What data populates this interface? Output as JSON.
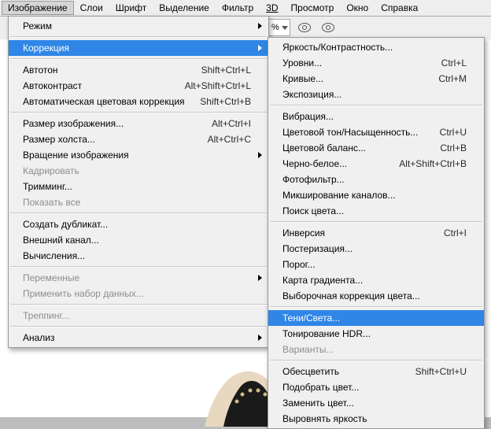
{
  "menubar": {
    "items": [
      {
        "label": "Изображение",
        "active": true
      },
      {
        "label": "Слои"
      },
      {
        "label": "Шрифт"
      },
      {
        "label": "Выделение"
      },
      {
        "label": "Фильтр"
      },
      {
        "label": "3D"
      },
      {
        "label": "Просмотр"
      },
      {
        "label": "Окно"
      },
      {
        "label": "Справка"
      }
    ]
  },
  "toolbar": {
    "percent_suffix": "%"
  },
  "menu1": {
    "mode": "Режим",
    "correction": "Коррекция",
    "autotone": "Автотон",
    "autotone_sc": "Shift+Ctrl+L",
    "autocontrast": "Автоконтраст",
    "autocontrast_sc": "Alt+Shift+Ctrl+L",
    "autocolor": "Автоматическая цветовая коррекция",
    "autocolor_sc": "Shift+Ctrl+B",
    "imagesize": "Размер изображения...",
    "imagesize_sc": "Alt+Ctrl+I",
    "canvassize": "Размер холста...",
    "canvassize_sc": "Alt+Ctrl+C",
    "rotate": "Вращение изображения",
    "crop": "Кадрировать",
    "trim": "Тримминг...",
    "revealall": "Показать все",
    "duplicate": "Создать дубликат...",
    "apply": "Внешний канал...",
    "calc": "Вычисления...",
    "vars": "Переменные",
    "applyset": "Применить набор данных...",
    "trap": "Треппинг...",
    "analysis": "Анализ"
  },
  "menu2": {
    "brightness": "Яркость/Контрастность...",
    "levels": "Уровни...",
    "levels_sc": "Ctrl+L",
    "curves": "Кривые...",
    "curves_sc": "Ctrl+M",
    "exposure": "Экспозиция...",
    "vibrance": "Вибрация...",
    "hue": "Цветовой тон/Насыщенность...",
    "hue_sc": "Ctrl+U",
    "balance": "Цветовой баланс...",
    "balance_sc": "Ctrl+B",
    "bw": "Черно-белое...",
    "bw_sc": "Alt+Shift+Ctrl+B",
    "photo": "Фотофильтр...",
    "mixer": "Микширование каналов...",
    "lookup": "Поиск цвета...",
    "inversion": "Инверсия",
    "inversion_sc": "Ctrl+I",
    "poster": "Постеризация...",
    "threshold": "Порог...",
    "gradient": "Карта градиента...",
    "selective": "Выборочная коррекция цвета...",
    "shadow": "Тени/Света...",
    "hdr": "Тонирование HDR...",
    "variants": "Варианты...",
    "desat": "Обесцветить",
    "desat_sc": "Shift+Ctrl+U",
    "match": "Подобрать цвет...",
    "replace": "Заменить цвет...",
    "equalize": "Выровнять яркость"
  }
}
